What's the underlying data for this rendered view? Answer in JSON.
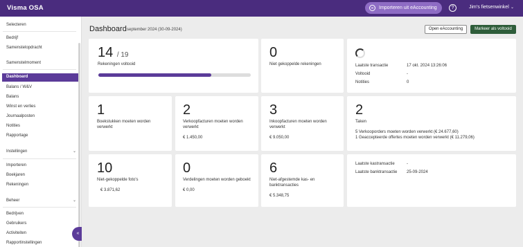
{
  "topbar": {
    "brand": "Visma OSA",
    "import_label": "Importeren uit eAccounting",
    "help_glyph": "?",
    "company": "Jim's fietsenwinkel"
  },
  "sidebar": {
    "select_label": "Selecteren",
    "select_items": [
      "Bedrijf",
      "Samenstelopdracht"
    ],
    "compile_label": "Samenstelmoment",
    "compile_items": [
      "Dashboard",
      "Balans / W&V",
      "Balans",
      "Winst en verlies",
      "Journaalposten",
      "Notities",
      "Rapportage"
    ],
    "settings_label": "Instellingen",
    "settings_items": [
      "Importeren",
      "Boekjaren",
      "Rekeningen"
    ],
    "admin_label": "Beheer",
    "admin_items": [
      "Bedrijven",
      "Gebruikers",
      "Activiteiten",
      "Rapportinstellingen"
    ],
    "collapse_glyph": "«"
  },
  "header": {
    "title": "Dashboard",
    "period": "september 2024 (30-09-2024)",
    "open_button": "Open eAccounting",
    "mark_button": "Markeer als voltooid"
  },
  "cards": {
    "accounts": {
      "done": "14",
      "total": "/ 19",
      "label": "Rekeningen voltooid",
      "progress": 0.74
    },
    "unlinked": {
      "value": "0",
      "label": "Niet gekoppelde rekeningen"
    },
    "transaction": {
      "rows": [
        {
          "label": "Laatste transactie",
          "value": "17 okt. 2024 13:26:06"
        },
        {
          "label": "Voltooid",
          "value": "-"
        },
        {
          "label": "Notities",
          "value": "0"
        }
      ]
    },
    "journal": {
      "value": "1",
      "label": "Boekstukken moeten worden verwerkt"
    },
    "sales": {
      "value": "2",
      "label": "Verkoopfacturen moeten worden verwerkt",
      "amount": "€ 1.450,00"
    },
    "purchase": {
      "value": "3",
      "label": "Inkoopfacturen moeten worden verwerkt",
      "amount": "€ 9.050,00"
    },
    "tasks": {
      "value": "2",
      "label": "Taken",
      "lines": [
        "5 Verkooporders moeten worden verwerkt (€ 24.677,60)",
        "1 Geaccepteerde offertes moeten worden verwerkt (€ 11.279,06)"
      ]
    },
    "photos": {
      "value": "10",
      "label": "Niet-gekoppelde foto's",
      "amount": "€ 3.871,62"
    },
    "allocations": {
      "value": "0",
      "label": "Verdelingen moeten worden geboekt",
      "amount": "€ 0,00"
    },
    "cashbank": {
      "value": "6",
      "label": "Niet-afgestemde kas- en banktransacties",
      "amount": "€ 5.348,75"
    },
    "latest": {
      "rows": [
        {
          "label": "Laatste kastransactie",
          "value": "-"
        },
        {
          "label": "Laatste banktransactie",
          "value": "25-09-2024"
        }
      ]
    }
  }
}
